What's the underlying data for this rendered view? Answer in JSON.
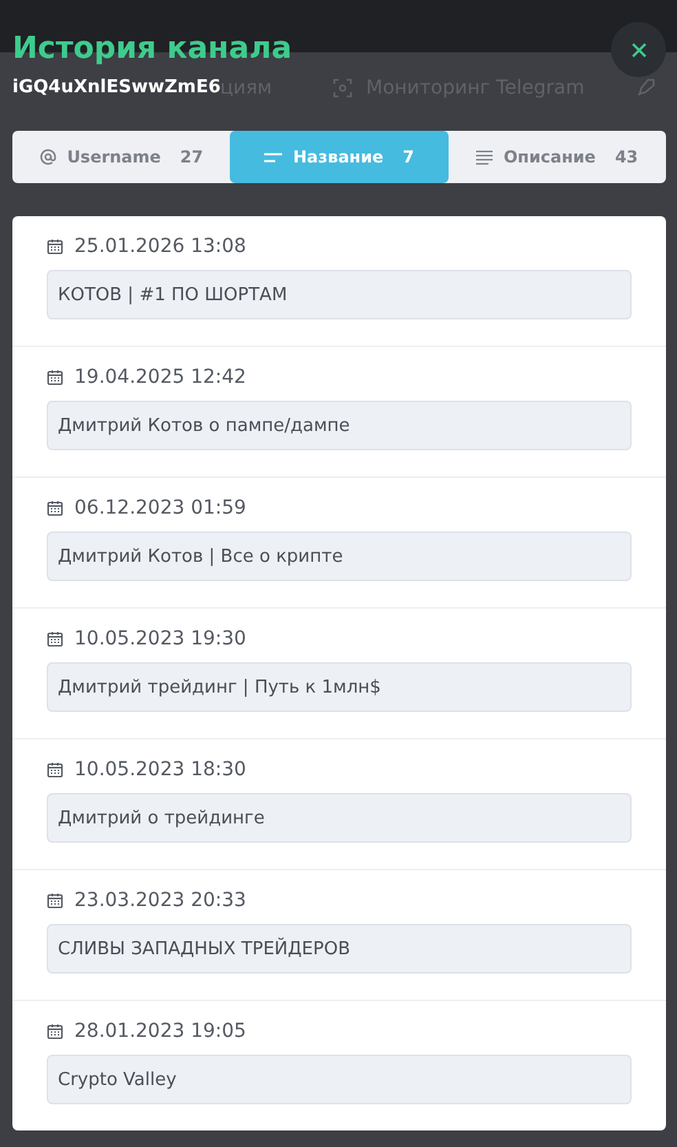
{
  "backdrop": {
    "nav_items": [
      {
        "label": "циям",
        "kind": "text"
      },
      {
        "label": "Мониторинг Telegram",
        "kind": "scan"
      }
    ]
  },
  "modal": {
    "title": "История канала",
    "subtitle": "iGQ4uXnlESwwZmE6",
    "tabs": [
      {
        "label": "Username",
        "count": "27",
        "kind": "at",
        "selected": false
      },
      {
        "label": "Название",
        "count": "7",
        "kind": "lines",
        "selected": true
      },
      {
        "label": "Описание",
        "count": "43",
        "kind": "text",
        "selected": false
      }
    ],
    "entries": [
      {
        "date": "25.01.2026 13:08",
        "value": "КОТОВ | #1 ПО ШОРТАМ"
      },
      {
        "date": "19.04.2025 12:42",
        "value": "Дмитрий Котов о пампе/дампе"
      },
      {
        "date": "06.12.2023 01:59",
        "value": "Дмитрий Котов | Все о крипте"
      },
      {
        "date": "10.05.2023 19:30",
        "value": "Дмитрий трейдинг | Путь к 1млн$"
      },
      {
        "date": "10.05.2023 18:30",
        "value": "Дмитрий о трейдинге"
      },
      {
        "date": "23.03.2023 20:33",
        "value": "СЛИВЫ ЗАПАДНЫХ ТРЕЙДЕРОВ"
      },
      {
        "date": "28.01.2023 19:05",
        "value": "Crypto Valley"
      }
    ]
  }
}
